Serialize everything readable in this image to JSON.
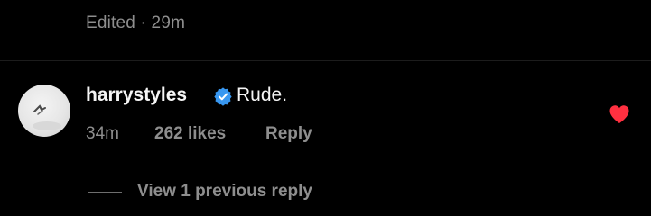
{
  "previous_comment": {
    "edited_label": "Edited · 29m"
  },
  "comment": {
    "username": "harrystyles",
    "text": "Rude.",
    "time": "34m",
    "likes": "262 likes",
    "reply_label": "Reply",
    "verified": true,
    "liked": true
  },
  "replies": {
    "view_label": "View 1 previous reply"
  },
  "icons": {
    "verified": "verified-badge-icon",
    "heart": "heart-icon",
    "avatar": "avatar"
  },
  "colors": {
    "background": "#000000",
    "text_primary": "#f5f5f5",
    "text_secondary": "#8e8e8e",
    "verified_blue": "#3897f0",
    "heart_red": "#ff3040"
  }
}
